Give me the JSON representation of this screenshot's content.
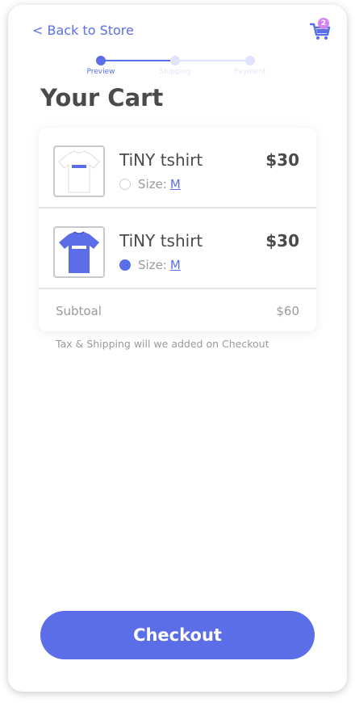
{
  "header": {
    "back_label": "< Back to Store",
    "cart_icon": "cart-icon",
    "cart_count": "2"
  },
  "stepper": {
    "steps": [
      {
        "label": "Preview",
        "active": true
      },
      {
        "label": "Shipping",
        "active": false
      },
      {
        "label": "Payment",
        "active": false
      }
    ]
  },
  "title": "Your Cart",
  "cart": {
    "items": [
      {
        "name": "TiNY tshirt",
        "price": "$30",
        "size_label": "Size:",
        "size_value": "M",
        "shirt_color": "#ffffff",
        "print_color": "#5b6ee8",
        "selected": false
      },
      {
        "name": "TiNY tshirt",
        "price": "$30",
        "size_label": "Size:",
        "size_value": "M",
        "shirt_color": "#5b6ee8",
        "print_color": "#ffffff",
        "selected": true
      }
    ],
    "subtotal_label": "Subtoal",
    "subtotal_value": "$60"
  },
  "note": "Tax & Shipping will we added on Checkout",
  "checkout_label": "Checkout",
  "colors": {
    "accent": "#5b6ee8",
    "text": "#4a4a4a",
    "muted": "#9a9a9a"
  }
}
